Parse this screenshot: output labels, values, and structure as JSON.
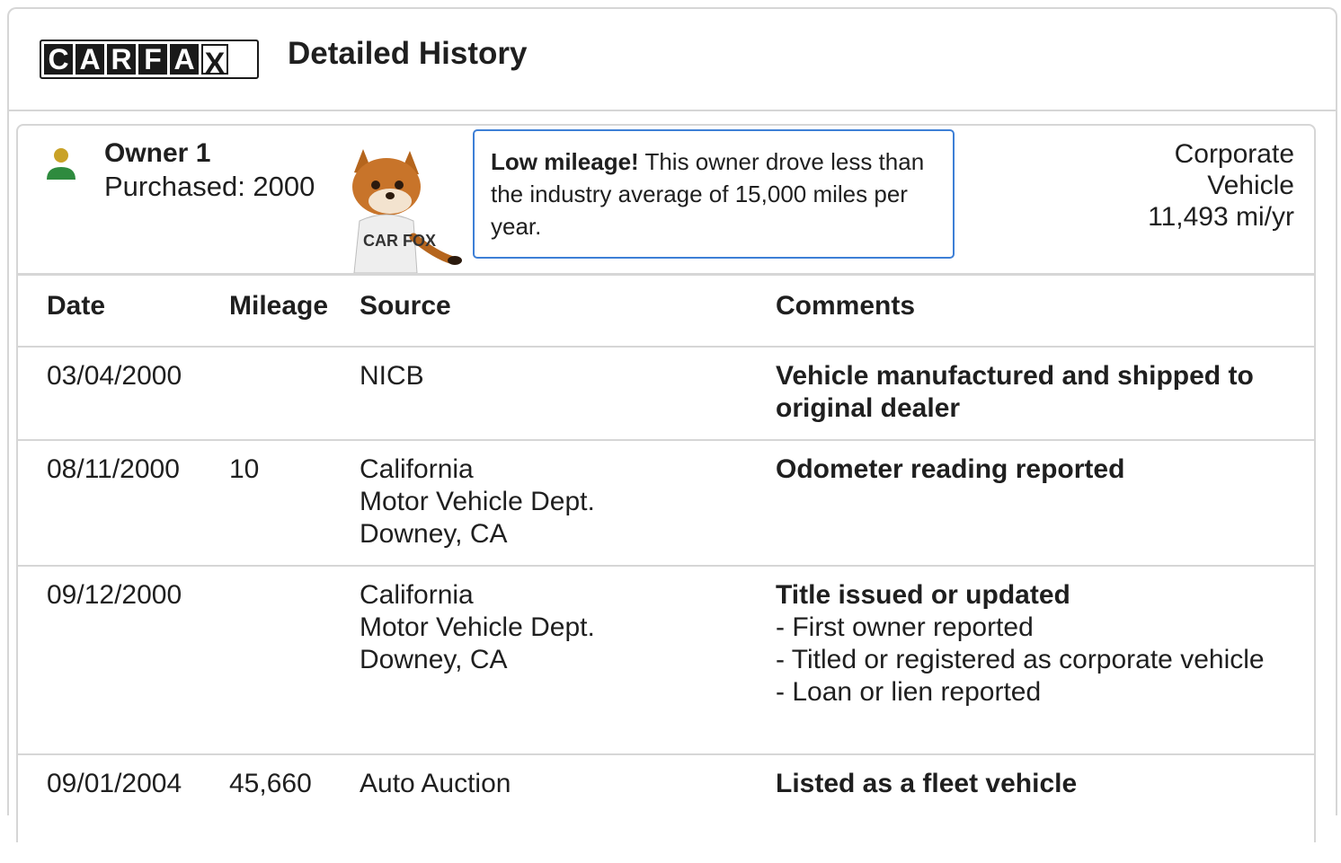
{
  "header": {
    "logo_letters": [
      "C",
      "A",
      "R",
      "F",
      "A",
      "X"
    ],
    "title": "Detailed History"
  },
  "owner": {
    "name": "Owner 1",
    "purchased": "Purchased: 2000",
    "callout_bold": "Low mileage!",
    "callout_text": " This owner drove less than the industry average of 15,000 miles per year.",
    "type_line1": "Corporate",
    "type_line2": "Vehicle",
    "mileage_rate": "11,493 mi/yr",
    "mascot_shirt": "CAR FOX"
  },
  "table": {
    "headers": [
      "Date",
      "Mileage",
      "Source",
      "Comments"
    ],
    "rows": [
      {
        "date": "03/04/2000",
        "mileage": "",
        "source": [
          "NICB"
        ],
        "comment_title": "Vehicle manufactured and shipped to original dealer",
        "comment_items": []
      },
      {
        "date": "08/11/2000",
        "mileage": "10",
        "source": [
          "California",
          "Motor Vehicle Dept.",
          "Downey, CA"
        ],
        "comment_title": "Odometer reading reported",
        "comment_items": []
      },
      {
        "date": "09/12/2000",
        "mileage": "",
        "source": [
          "California",
          "Motor Vehicle Dept.",
          "Downey, CA"
        ],
        "comment_title": "Title issued or updated",
        "comment_items": [
          "- First owner reported",
          "- Titled or registered as corporate vehicle",
          "- Loan or lien reported"
        ]
      },
      {
        "date": "09/01/2004",
        "mileage": "45,660",
        "source": [
          "Auto Auction"
        ],
        "comment_title": "Listed as a fleet vehicle",
        "comment_items": []
      }
    ]
  },
  "colors": {
    "border": "#d6d6d6",
    "callout_border": "#3d7fd6",
    "owner_icon_head": "#c9a227",
    "owner_icon_body": "#2e8b3e"
  }
}
